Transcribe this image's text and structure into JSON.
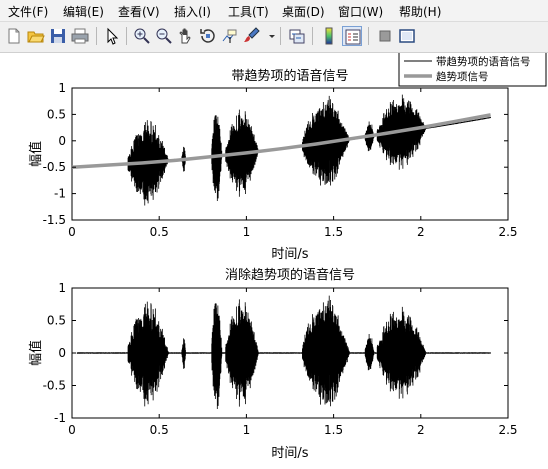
{
  "menu": {
    "items": [
      {
        "label": "文件(F)"
      },
      {
        "label": "编辑(E)"
      },
      {
        "label": "查看(V)"
      },
      {
        "label": "插入(I)"
      },
      {
        "label": "工具(T)"
      },
      {
        "label": "桌面(D)"
      },
      {
        "label": "窗口(W)"
      },
      {
        "label": "帮助(H)"
      }
    ]
  },
  "toolbar": {
    "icons": [
      "new-figure-icon",
      "open-file-icon",
      "save-icon",
      "print-icon",
      "pointer-icon",
      "zoom-in-icon",
      "zoom-out-icon",
      "pan-icon",
      "rotate-3d-icon",
      "data-cursor-icon",
      "brush-icon",
      "brush-dropdown-icon",
      "link-plot-icon",
      "colorbar-icon",
      "legend-icon",
      "hide-plot-tools-icon",
      "show-plot-tools-icon"
    ]
  },
  "chart_data": [
    {
      "type": "line",
      "title": "带趋势项的语音信号",
      "xlabel": "时间/s",
      "ylabel": "幅值",
      "xlim": [
        0,
        2.5
      ],
      "ylim": [
        -1.5,
        1
      ],
      "xticks": [
        "0",
        "0.5",
        "1",
        "1.5",
        "2",
        "2.5"
      ],
      "yticks": [
        "-1.5",
        "-1",
        "-0.5",
        "0",
        "0.5",
        "1"
      ],
      "legend": {
        "position": "top-right",
        "entries": [
          "带趋势项的语音信号",
          "趋势项信号"
        ]
      },
      "series": [
        {
          "name": "带趋势项的语音信号",
          "color": "#000000",
          "envelope": [
            [
              0,
              -0.5
            ],
            [
              0.3,
              -0.45
            ],
            [
              0.33,
              -0.1
            ],
            [
              0.4,
              0.05
            ],
            [
              0.5,
              0.05
            ],
            [
              0.6,
              0.1
            ],
            [
              0.66,
              -0.35
            ],
            [
              0.72,
              -0.3
            ],
            [
              0.8,
              0.2
            ],
            [
              0.85,
              0.25
            ],
            [
              0.95,
              0.2
            ],
            [
              1.05,
              0.05
            ],
            [
              1.12,
              -0.2
            ],
            [
              1.2,
              -0.15
            ],
            [
              1.35,
              0.2
            ],
            [
              1.45,
              0.35
            ],
            [
              1.55,
              0.3
            ],
            [
              1.65,
              0.15
            ],
            [
              1.75,
              0.2
            ],
            [
              1.9,
              0.4
            ],
            [
              2.05,
              0.35
            ],
            [
              2.1,
              0.2
            ],
            [
              2.2,
              0.25
            ],
            [
              2.4,
              0.45
            ]
          ]
        },
        {
          "name": "趋势项信号",
          "color": "#999999",
          "x": [
            0,
            0.2,
            0.4,
            0.6,
            0.8,
            1.0,
            1.2,
            1.4,
            1.6,
            1.8,
            2.0,
            2.2,
            2.4
          ],
          "y": [
            -0.5,
            -0.46,
            -0.42,
            -0.37,
            -0.3,
            -0.23,
            -0.15,
            -0.06,
            0.04,
            0.14,
            0.25,
            0.37,
            0.49
          ]
        }
      ]
    },
    {
      "type": "line",
      "title": "消除趋势项的语音信号",
      "xlabel": "时间/s",
      "ylabel": "幅值",
      "xlim": [
        0,
        2.5
      ],
      "ylim": [
        -1,
        1
      ],
      "xticks": [
        "0",
        "0.5",
        "1",
        "1.5",
        "2",
        "2.5"
      ],
      "yticks": [
        "-1",
        "-0.5",
        "0",
        "0.5",
        "1"
      ],
      "series": [
        {
          "color": "#000000",
          "x": [
            0.03,
            2.4
          ]
        }
      ]
    }
  ]
}
